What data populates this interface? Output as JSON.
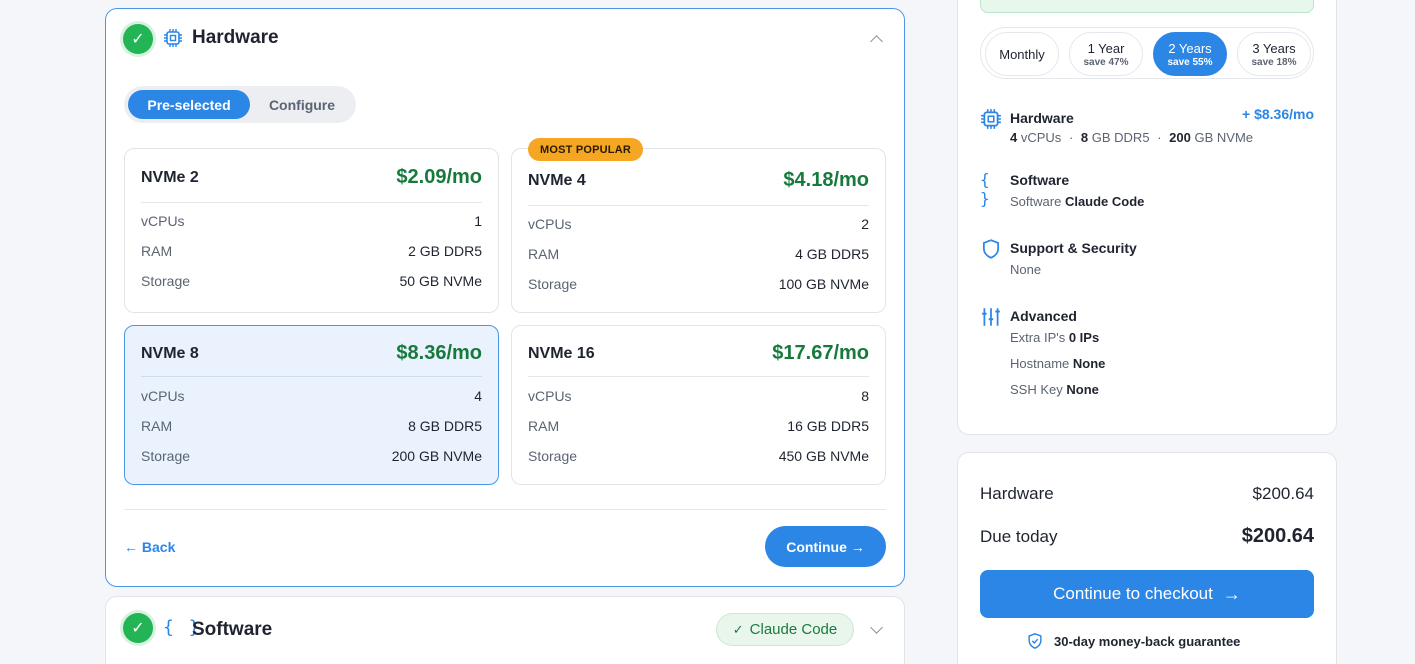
{
  "hardware": {
    "title": "Hardware",
    "tabs": {
      "preselected": "Pre-selected",
      "configure": "Configure"
    },
    "plans": [
      {
        "name": "NVMe 2",
        "price": "$2.09/mo",
        "badge": "",
        "specs": [
          {
            "label": "vCPUs",
            "value": "1"
          },
          {
            "label": "RAM",
            "value": "2 GB DDR5"
          },
          {
            "label": "Storage",
            "value": "50 GB NVMe"
          }
        ]
      },
      {
        "name": "NVMe 4",
        "price": "$4.18/mo",
        "badge": "MOST POPULAR",
        "specs": [
          {
            "label": "vCPUs",
            "value": "2"
          },
          {
            "label": "RAM",
            "value": "4 GB DDR5"
          },
          {
            "label": "Storage",
            "value": "100 GB NVMe"
          }
        ]
      },
      {
        "name": "NVMe 8",
        "price": "$8.36/mo",
        "badge": "",
        "specs": [
          {
            "label": "vCPUs",
            "value": "4"
          },
          {
            "label": "RAM",
            "value": "8 GB DDR5"
          },
          {
            "label": "Storage",
            "value": "200 GB NVMe"
          }
        ]
      },
      {
        "name": "NVMe 16",
        "price": "$17.67/mo",
        "badge": "",
        "specs": [
          {
            "label": "vCPUs",
            "value": "8"
          },
          {
            "label": "RAM",
            "value": "16 GB DDR5"
          },
          {
            "label": "Storage",
            "value": "450 GB NVMe"
          }
        ]
      }
    ],
    "selected_plan": "NVMe 8",
    "back_label": "← Back",
    "continue_label": "Continue →"
  },
  "software": {
    "title": "Software",
    "selected_pill": "Claude Code"
  },
  "summary": {
    "terms": [
      {
        "label": "Monthly",
        "save": ""
      },
      {
        "label": "1 Year",
        "save": "save 47%"
      },
      {
        "label": "2 Years",
        "save": "save 55%"
      },
      {
        "label": "3 Years",
        "save": "save 18%"
      }
    ],
    "active_term": "2 Years",
    "hardware": {
      "title": "Hardware",
      "price": "+ $8.36/mo",
      "cpu_val": "4",
      "cpu_unit": "vCPUs",
      "ram_val": "8",
      "ram_unit": "GB DDR5",
      "disk_val": "200",
      "disk_unit": "GB NVMe",
      "sep": "·"
    },
    "software": {
      "title": "Software",
      "prefix": "Software",
      "value": "Claude Code"
    },
    "support": {
      "title": "Support & Security",
      "value": "None"
    },
    "advanced": {
      "title": "Advanced",
      "extra_ips_label": "Extra IP's",
      "extra_ips_value": "0 IPs",
      "hostname_label": "Hostname",
      "hostname_value": "None",
      "ssh_label": "SSH Key",
      "ssh_value": "None"
    }
  },
  "totals": {
    "hardware_label": "Hardware",
    "hardware_value": "$200.64",
    "due_label": "Due today",
    "due_value": "$200.64",
    "checkout_label": "Continue to checkout",
    "guarantee": "30-day money-back guarantee"
  },
  "colors": {
    "accent": "#2b86e6",
    "success": "#22b455",
    "price_green": "#177a3c",
    "badge": "#f5a623"
  }
}
